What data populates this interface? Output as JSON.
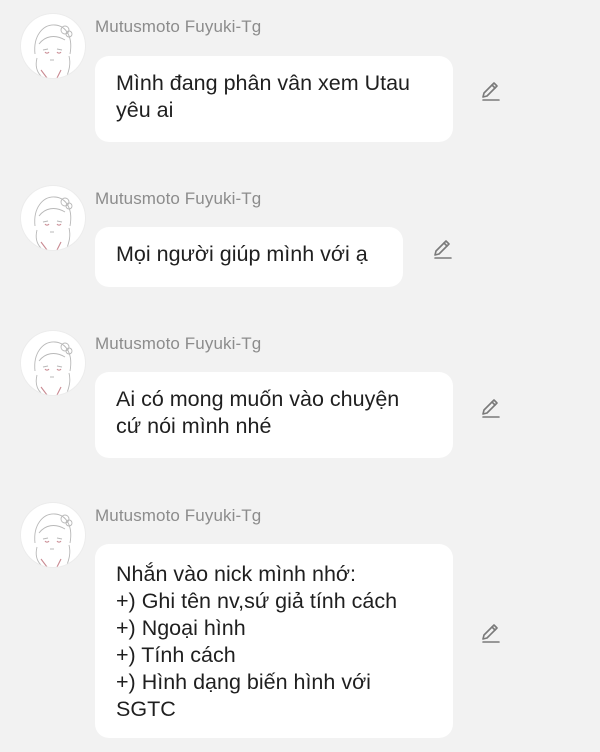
{
  "messages": [
    {
      "sender": "Mutusmoto Fuyuki-Tg",
      "lines": [
        "Mình đang phân vân xem Utau",
        "yêu ai"
      ],
      "avatar_icon": "anime-girl-avatar",
      "edit_icon": "pencil-icon"
    },
    {
      "sender": "Mutusmoto Fuyuki-Tg",
      "lines": [
        "Mọi người giúp mình với ạ"
      ],
      "avatar_icon": "anime-girl-avatar",
      "edit_icon": "pencil-icon"
    },
    {
      "sender": "Mutusmoto Fuyuki-Tg",
      "lines": [
        "Ai có mong muốn vào chuyện",
        "cứ nói mình nhé"
      ],
      "avatar_icon": "anime-girl-avatar",
      "edit_icon": "pencil-icon"
    },
    {
      "sender": "Mutusmoto Fuyuki-Tg",
      "lines": [
        "Nhắn vào nick mình nhớ:",
        "+) Ghi tên nv,sứ giả tính cách",
        "+) Ngoại hình",
        "+) Tính cách",
        "+) Hình dạng biến hình với",
        "SGTC"
      ],
      "avatar_icon": "anime-girl-avatar",
      "edit_icon": "pencil-icon"
    }
  ],
  "colors": {
    "background": "#f2f2f2",
    "bubble": "#ffffff",
    "sender_text": "#8c8c8c",
    "message_text": "#1f1f1f",
    "icon": "#7a7a7a",
    "avatar_accent": "#c98a92"
  }
}
